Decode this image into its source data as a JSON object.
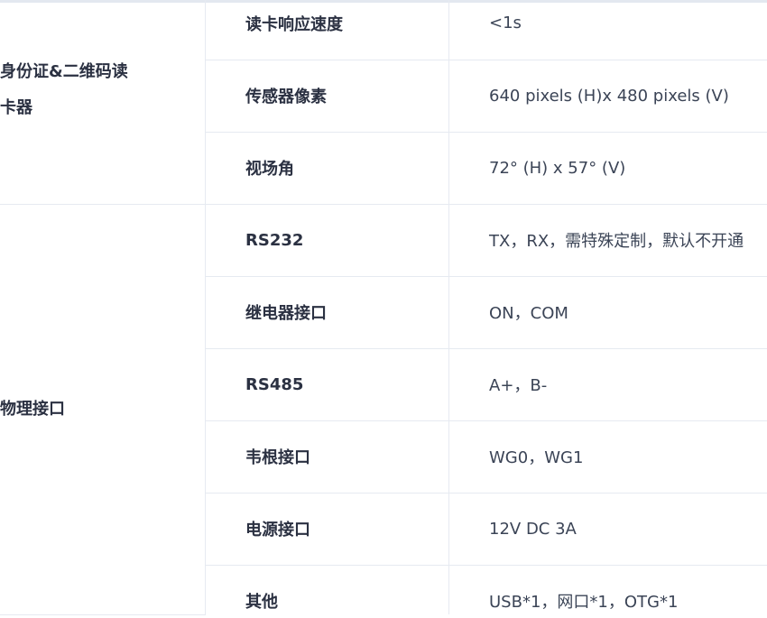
{
  "groups": [
    {
      "name": "身份证&二维码读卡器",
      "rows": [
        {
          "label": "读卡响应速度",
          "value": "<1s"
        },
        {
          "label": "传感器像素",
          "value": "640 pixels (H)x 480 pixels (V)"
        },
        {
          "label": "视场角",
          "value": "72° (H) x 57° (V)"
        }
      ]
    },
    {
      "name": "物理接口",
      "rows": [
        {
          "label": "RS232",
          "value": "TX，RX，需特殊定制，默认不开通"
        },
        {
          "label": "继电器接口",
          "value": "ON，COM"
        },
        {
          "label": "RS485",
          "value": "A+，B-"
        },
        {
          "label": "韦根接口",
          "value": "WG0，WG1"
        },
        {
          "label": "电源接口",
          "value": "12V DC 3A"
        },
        {
          "label": "其他",
          "value": "USB*1，网口*1，OTG*1"
        }
      ]
    }
  ],
  "colors": {
    "border": "#e6eaf1",
    "label_text": "#2b3142",
    "value_text": "#3b4456"
  }
}
